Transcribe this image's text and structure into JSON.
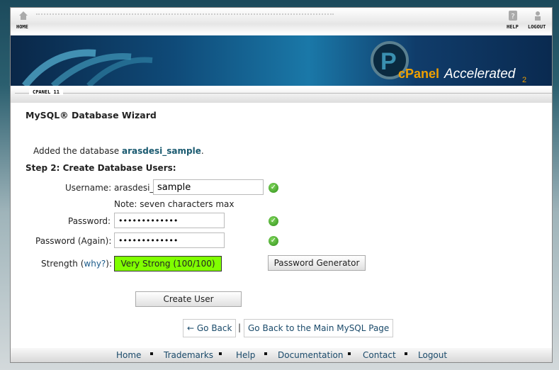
{
  "topbar": {
    "home": "HOME",
    "help": "HELP",
    "logout": "LOGOUT"
  },
  "banner": {
    "logo_text": "cPanel Accelerated 2"
  },
  "version": "CPANEL 11",
  "page": {
    "title": "MySQL® Database Wizard",
    "added_prefix": "Added the database ",
    "added_db": "arasdesi_sample",
    "added_suffix": ".",
    "step": "Step 2: Create Database Users:",
    "username_label": "Username:",
    "username_prefix": "arasdesi_",
    "username_value": "sample",
    "note": "Note: seven characters max",
    "password_label": "Password:",
    "password_again_label": "Password (Again):",
    "strength_label": "Strength (",
    "why_link": "why?",
    "strength_suffix": "):",
    "strength_value": "Very Strong (100/100)",
    "strength_score": 100,
    "strength_color": "#80ff00",
    "password_generator": "Password Generator",
    "create_user": "Create User",
    "go_back": "← Go Back",
    "separator": "|",
    "main_mysql": "Go Back to the Main MySQL Page"
  },
  "footer": {
    "links": [
      "Home",
      "Trademarks",
      "Help",
      "Documentation",
      "Contact",
      "Logout"
    ]
  }
}
